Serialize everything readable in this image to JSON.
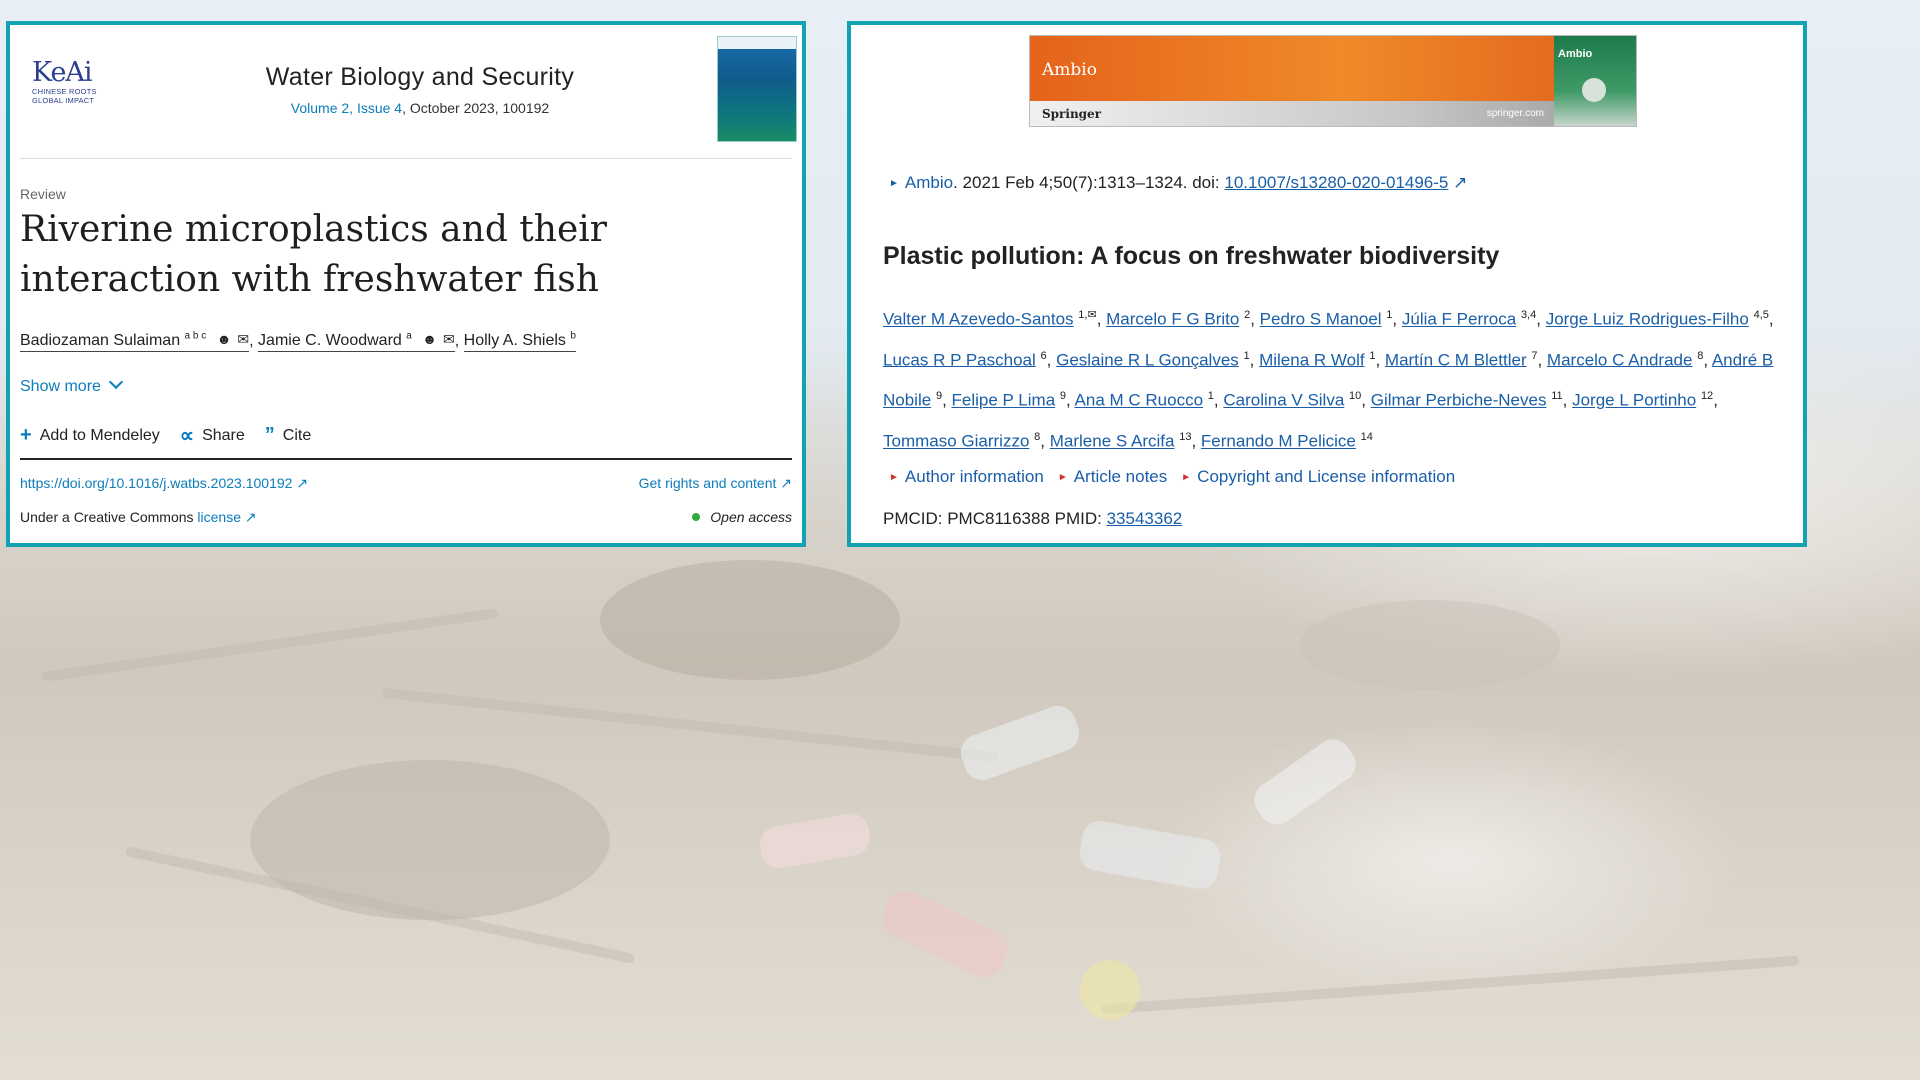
{
  "left_card": {
    "publisher_logo": "KeAi",
    "publisher_tagline_1": "CHINESE ROOTS",
    "publisher_tagline_2": "GLOBAL IMPACT",
    "journal_title": "Water Biology and Security",
    "volume_link": "Volume 2, Issue 4",
    "date_article": ", October 2023, 100192",
    "article_type": "Review",
    "title": "Riverine microplastics and their interaction with freshwater fish",
    "authors": [
      {
        "name": "Badiozaman Sulaiman",
        "sup": "a b c"
      },
      {
        "name": "Jamie C. Woodward",
        "sup": "a"
      },
      {
        "name": "Holly A. Shiels",
        "sup": "b"
      }
    ],
    "show_more": "Show more",
    "actions": {
      "mendeley": "Add to Mendeley",
      "share": "Share",
      "cite": "Cite"
    },
    "doi": "https://doi.org/10.1016/j.watbs.2023.100192 ↗",
    "rights": "Get rights and content ↗",
    "cc_prefix": "Under a Creative Commons ",
    "cc_link": "license ↗",
    "open_access": "Open access"
  },
  "right_card": {
    "banner_title": "Ambio",
    "banner_publisher": "Springer",
    "banner_url": "springer.com",
    "banner_thumb_title": "Ambio",
    "journal_link": "Ambio",
    "citation": ". 2021 Feb 4;50(7):1313–1324. doi: ",
    "doi": "10.1007/s13280-020-01496-5",
    "title": "Plastic pollution: A focus on freshwater biodiversity",
    "authors": [
      {
        "name": "Valter M Azevedo-Santos",
        "sup": "1,✉"
      },
      {
        "name": "Marcelo F G Brito",
        "sup": "2"
      },
      {
        "name": "Pedro S Manoel",
        "sup": "1"
      },
      {
        "name": "Júlia F Perroca",
        "sup": "3,4"
      },
      {
        "name": "Jorge Luiz Rodrigues-Filho",
        "sup": "4,5"
      },
      {
        "name": "Lucas R P Paschoal",
        "sup": "6"
      },
      {
        "name": "Geslaine R L Gonçalves",
        "sup": "1"
      },
      {
        "name": "Milena R Wolf",
        "sup": "1"
      },
      {
        "name": "Martín C M Blettler",
        "sup": "7"
      },
      {
        "name": "Marcelo C Andrade",
        "sup": "8"
      },
      {
        "name": "André B Nobile",
        "sup": "9"
      },
      {
        "name": "Felipe P Lima",
        "sup": "9"
      },
      {
        "name": "Ana M C Ruocco",
        "sup": "1"
      },
      {
        "name": "Carolina V Silva",
        "sup": "10"
      },
      {
        "name": "Gilmar Perbiche-Neves",
        "sup": "11"
      },
      {
        "name": "Jorge L Portinho",
        "sup": "12"
      },
      {
        "name": "Tommaso Giarrizzo",
        "sup": "8"
      },
      {
        "name": "Marlene S Arcifa",
        "sup": "13"
      },
      {
        "name": "Fernando M Pelicice",
        "sup": "14"
      }
    ],
    "links": [
      "Author information",
      "Article notes",
      "Copyright and License information"
    ],
    "pmcid": "PMCID: PMC8116388  PMID: ",
    "pmid": "33543362"
  }
}
